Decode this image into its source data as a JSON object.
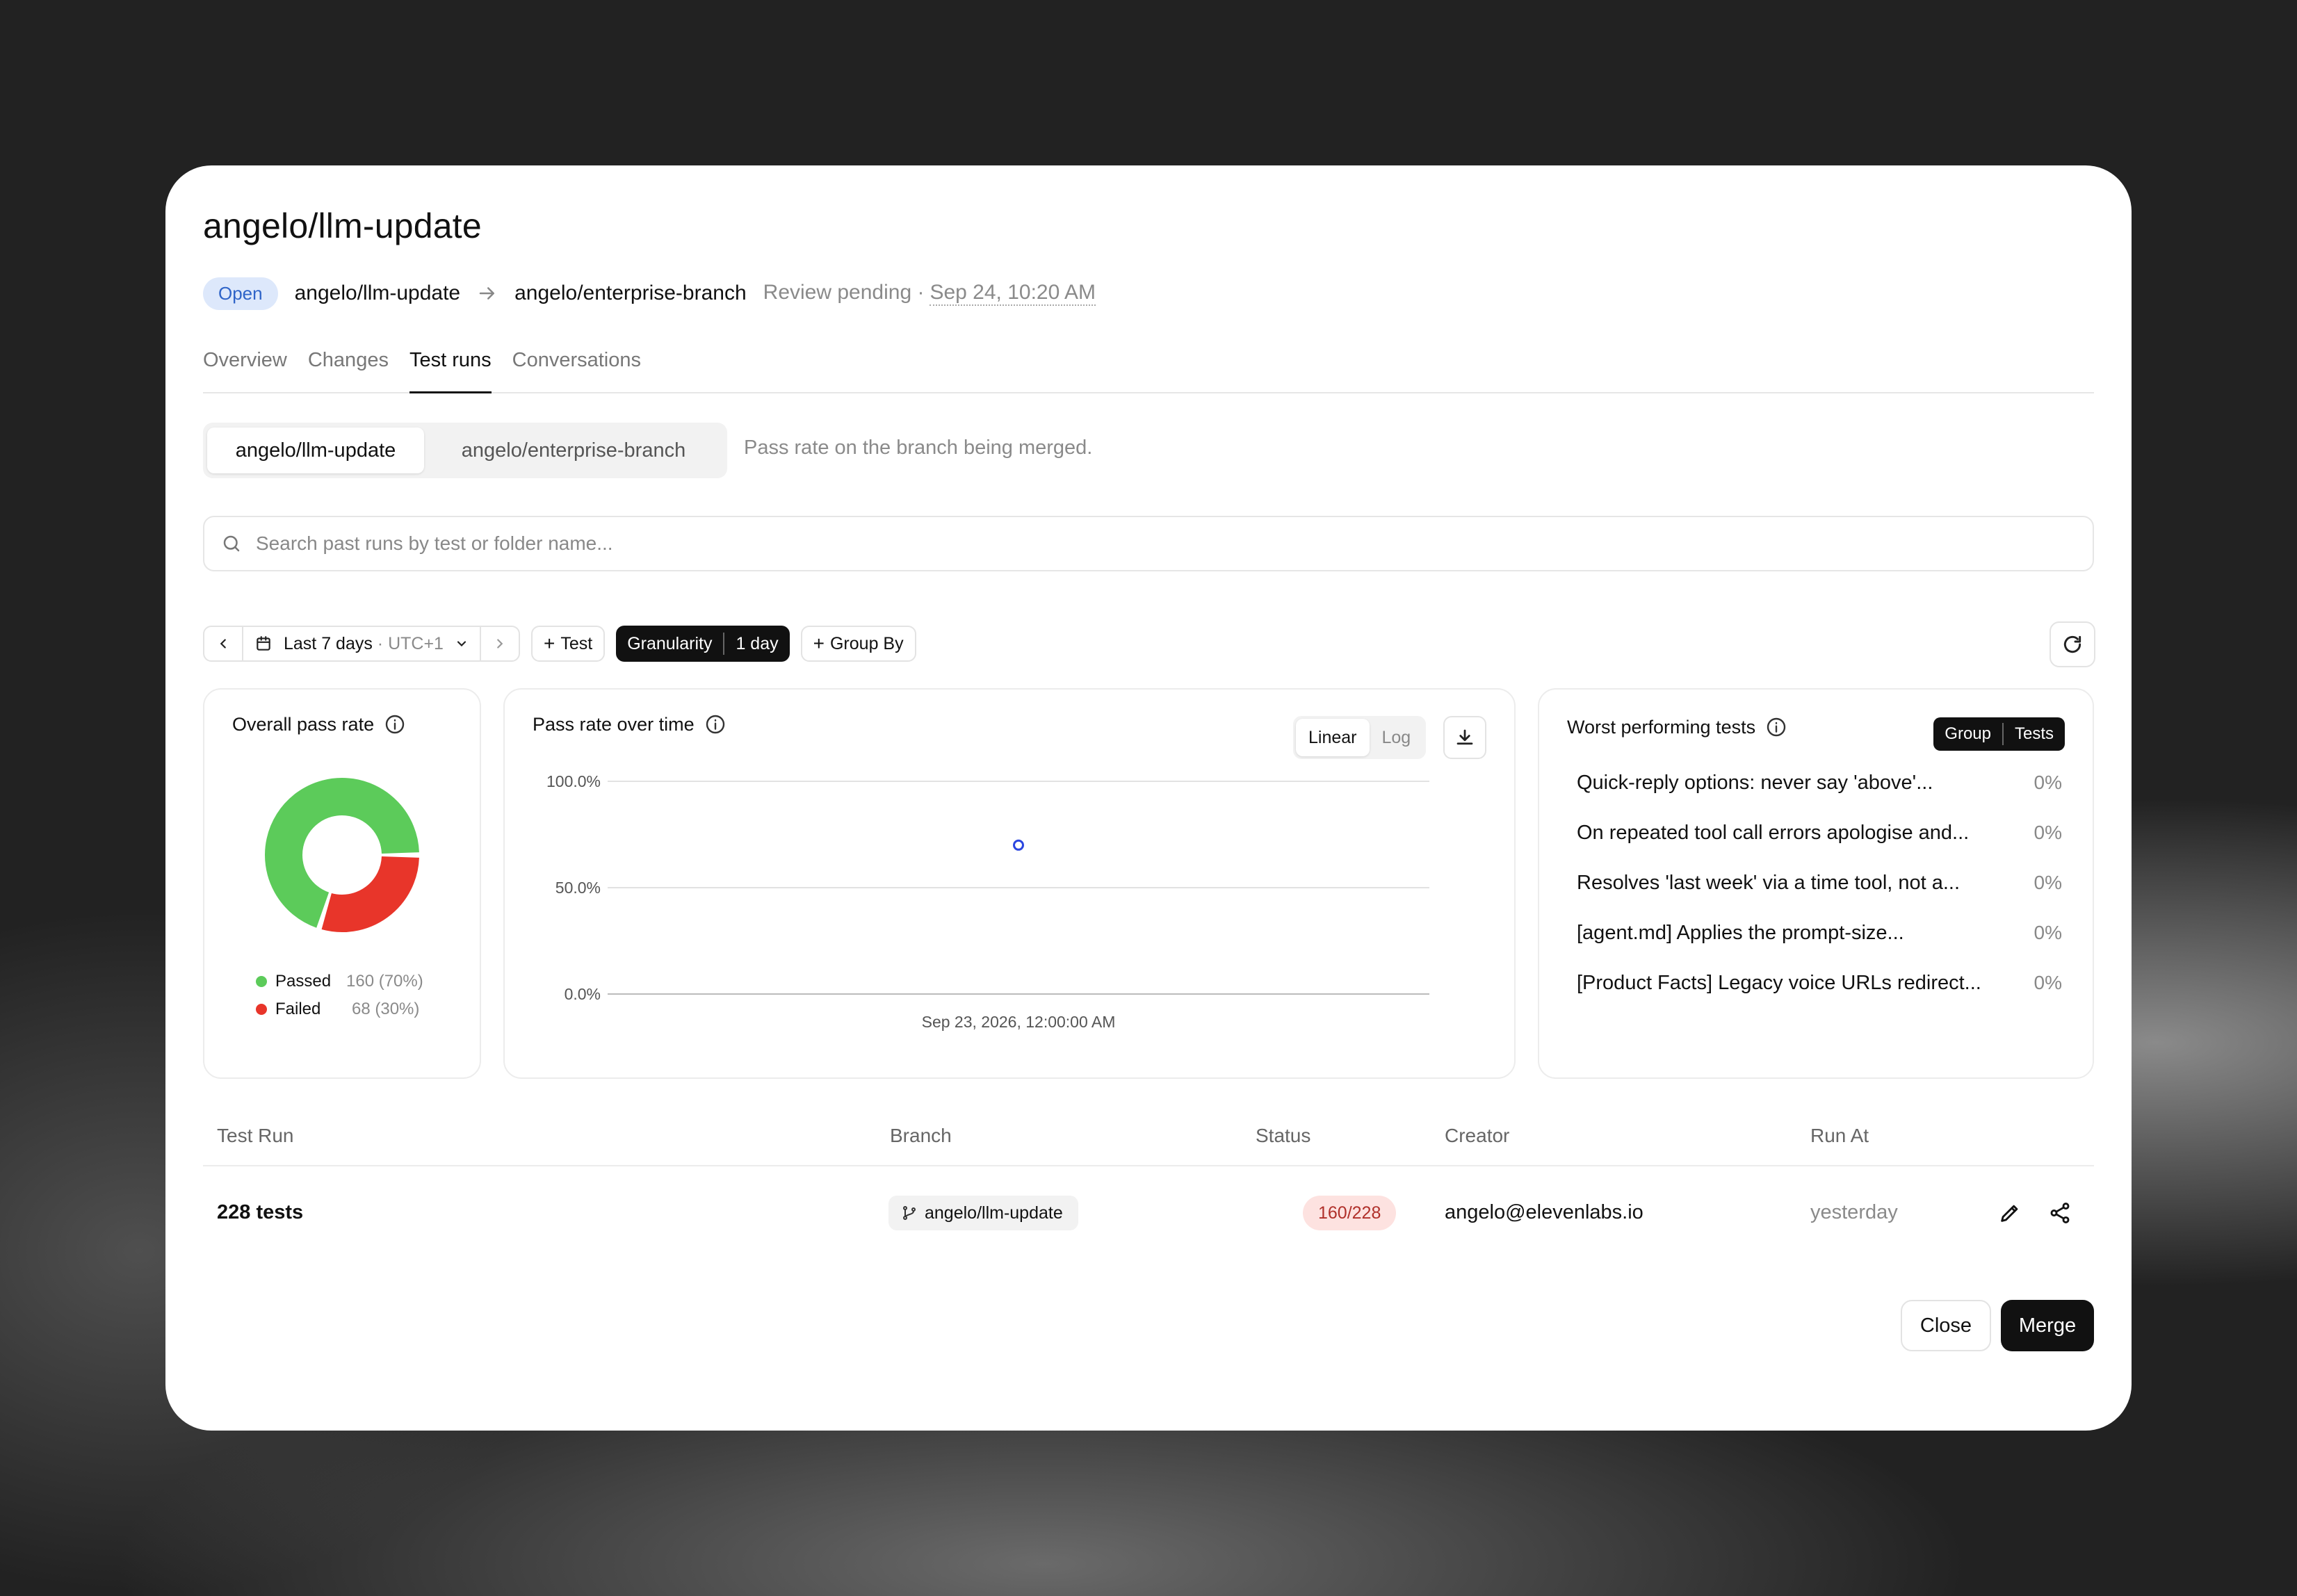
{
  "header": {
    "title": "angelo/llm-update",
    "status_badge": "Open",
    "source_branch": "angelo/llm-update",
    "target_branch": "angelo/enterprise-branch",
    "review_status": "Review pending ·",
    "date": "Sep 24, 10:20 AM"
  },
  "tabs": [
    {
      "label": "Overview"
    },
    {
      "label": "Changes"
    },
    {
      "label": "Test runs"
    },
    {
      "label": "Conversations"
    }
  ],
  "branch_toggle": {
    "active": "angelo/llm-update",
    "other": "angelo/enterprise-branch",
    "helper": "Pass rate on the branch being merged."
  },
  "search": {
    "placeholder": "Search past runs by test or folder name..."
  },
  "toolbar": {
    "range_label": "Last 7 days",
    "timezone": " · UTC+1",
    "test_label": "Test",
    "granularity_label": "Granularity",
    "granularity_value": "1 day",
    "group_by_label": "Group By"
  },
  "overall": {
    "title": "Overall pass rate",
    "passed_label": "Passed",
    "passed_value": "160 (70%)",
    "failed_label": "Failed",
    "failed_value": "68 (30%)",
    "passed_color": "#5ccb5a",
    "failed_color": "#e8352a"
  },
  "timeline": {
    "title": "Pass rate over time",
    "linear_label": "Linear",
    "log_label": "Log"
  },
  "chart_data": {
    "type": "scatter",
    "title": "Pass rate over time",
    "x": [
      "Sep 23, 2026, 12:00:00 AM"
    ],
    "y": [
      70
    ],
    "yticks": [
      "100.0%",
      "50.0%",
      "0.0%"
    ],
    "ylim": [
      0,
      100
    ],
    "scale": "linear",
    "grid": true
  },
  "worst": {
    "title": "Worst performing tests",
    "toggle_group": "Group",
    "toggle_tests": "Tests",
    "items": [
      {
        "name": "Quick-reply options: never say 'above'...",
        "rate": "0%"
      },
      {
        "name": "On repeated tool call errors apologise and...",
        "rate": "0%"
      },
      {
        "name": "Resolves 'last week' via a time tool, not a...",
        "rate": "0%"
      },
      {
        "name": "[agent.md] Applies the prompt-size...",
        "rate": "0%"
      },
      {
        "name": "[Product Facts] Legacy voice URLs redirect...",
        "rate": "0%"
      }
    ]
  },
  "table": {
    "headers": {
      "test_run": "Test Run",
      "branch": "Branch",
      "status": "Status",
      "creator": "Creator",
      "run_at": "Run At"
    },
    "rows": [
      {
        "test_run": "228 tests",
        "branch": "angelo/llm-update",
        "status": "160/228",
        "creator": "angelo@elevenlabs.io",
        "run_at": "yesterday"
      }
    ]
  },
  "footer": {
    "close_label": "Close",
    "merge_label": "Merge"
  }
}
